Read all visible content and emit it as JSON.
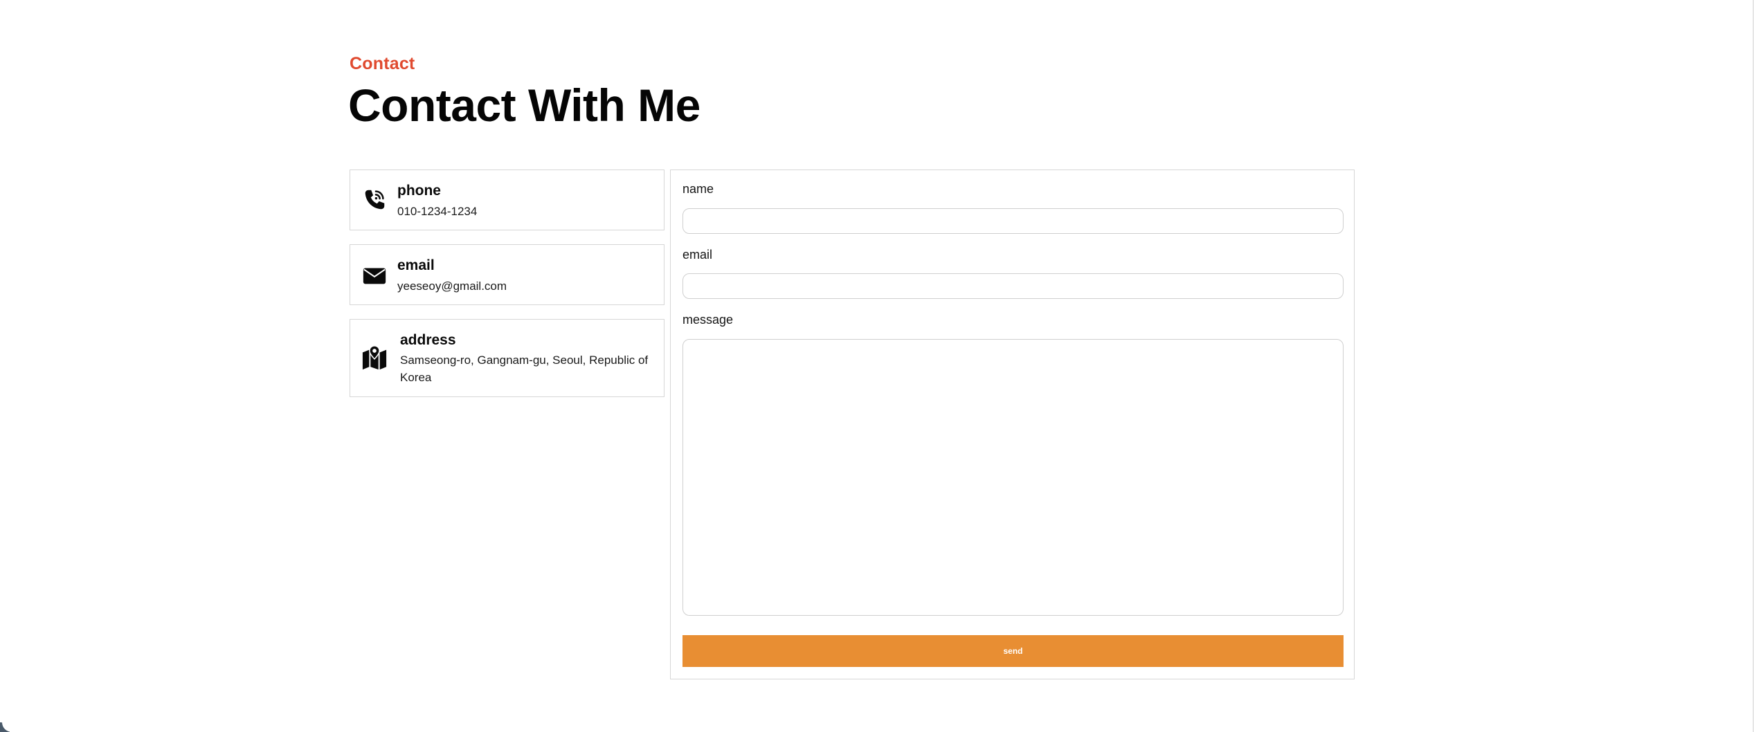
{
  "header": {
    "eyebrow": "Contact",
    "title": "Contact With Me"
  },
  "contact_info": {
    "phone": {
      "icon": "phone-icon",
      "label": "phone",
      "value": "010-1234-1234"
    },
    "email": {
      "icon": "envelope-icon",
      "label": "email",
      "value": "yeeseoy@gmail.com"
    },
    "address": {
      "icon": "map-pin-icon",
      "label": "address",
      "value": "Samseong-ro, Gangnam-gu, Seoul, Republic of Korea"
    }
  },
  "form": {
    "name_label": "name",
    "name_value": "",
    "email_label": "email",
    "email_value": "",
    "message_label": "message",
    "message_value": "",
    "send_label": "send"
  },
  "colors": {
    "accent": "#e04a2f",
    "button": "#e88e33",
    "border": "#d6d6d6"
  }
}
